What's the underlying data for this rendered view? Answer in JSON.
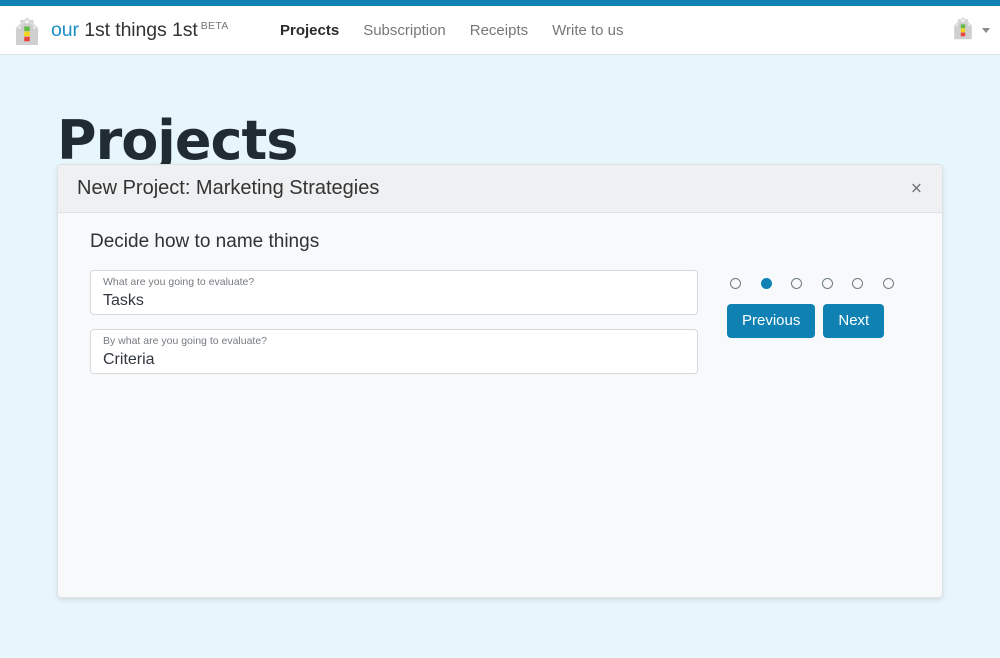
{
  "colors": {
    "accent": "#0f82b3",
    "page_background": "#e7f6fc",
    "panel_background": "#f8f9fa",
    "panel_header": "#eff0f1",
    "heading_text": "#212b33"
  },
  "navbar": {
    "logo_icon": "house-logo-icon",
    "brand": {
      "highlight": "our",
      "rest": "1st things 1st",
      "badge": "BETA"
    },
    "links": [
      {
        "label": "Projects",
        "active": true
      },
      {
        "label": "Subscription",
        "active": false
      },
      {
        "label": "Receipts",
        "active": false
      },
      {
        "label": "Write to us",
        "active": false
      }
    ],
    "user_menu": {
      "avatar_icon": "house-avatar-icon",
      "caret_icon": "chevron-down-icon"
    }
  },
  "page": {
    "title": "Projects"
  },
  "panel": {
    "title": "New Project: Marketing Strategies",
    "close_label": "×",
    "step_heading": "Decide how to name things",
    "fields": [
      {
        "label": "What are you going to evaluate?",
        "value": "Tasks",
        "placeholder": "What are you going to evaluate?"
      },
      {
        "label": "By what are you going to evaluate?",
        "value": "Criteria",
        "placeholder": "By what are you going to evaluate?"
      }
    ],
    "steps": {
      "total": 6,
      "current": 2
    },
    "buttons": {
      "previous": "Previous",
      "next": "Next"
    }
  }
}
